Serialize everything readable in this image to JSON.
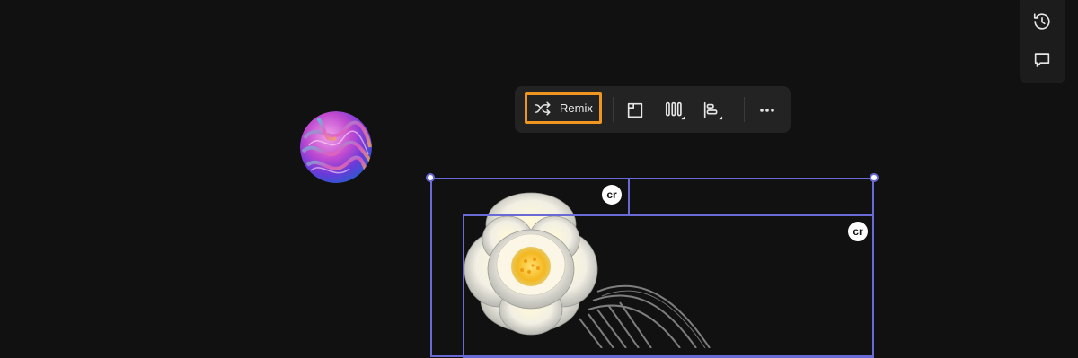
{
  "toolbar": {
    "remix_label": "Remix",
    "icons": [
      "remix-shuffle-icon",
      "frame-crop-icon",
      "distribute-columns-icon",
      "align-left-icon",
      "more-options-icon"
    ],
    "highlight_color": "#f0951f"
  },
  "side_panel": {
    "icons": [
      "history-icon",
      "comment-icon"
    ]
  },
  "canvas": {
    "background_color": "#111111",
    "selection_color": "#6a6ad6",
    "badges": [
      "cr",
      "cr"
    ]
  }
}
